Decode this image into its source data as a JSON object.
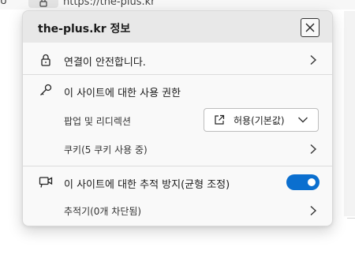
{
  "browser": {
    "left_glyph": "ט",
    "url": "https://the-plus.kr"
  },
  "popup": {
    "title": "the-plus.kr 정보",
    "connection": {
      "label": "연결이 안전합니다."
    },
    "permissions": {
      "heading": "이 사이트에 대한 사용 권한",
      "popup_redirect": {
        "label": "팝업 및 리디렉션",
        "selected_value": "허용(기본값)"
      },
      "cookies": {
        "label": "쿠키(5 쿠키 사용 중)"
      }
    },
    "tracking": {
      "heading": "이 사이트에 대한 추적 방지(균형 조정)",
      "toggle_on": true,
      "trackers": {
        "label": "추적기(0개 차단됨)"
      }
    }
  },
  "colors": {
    "accent": "#0b6fcf",
    "header_bg": "#e8e8e8",
    "popup_bg": "#f9f9f9"
  },
  "icons": [
    "lock-icon",
    "close-icon",
    "key-icon",
    "external-link-icon",
    "chevron-down-icon",
    "camera-icon",
    "chevron-right-icon"
  ]
}
